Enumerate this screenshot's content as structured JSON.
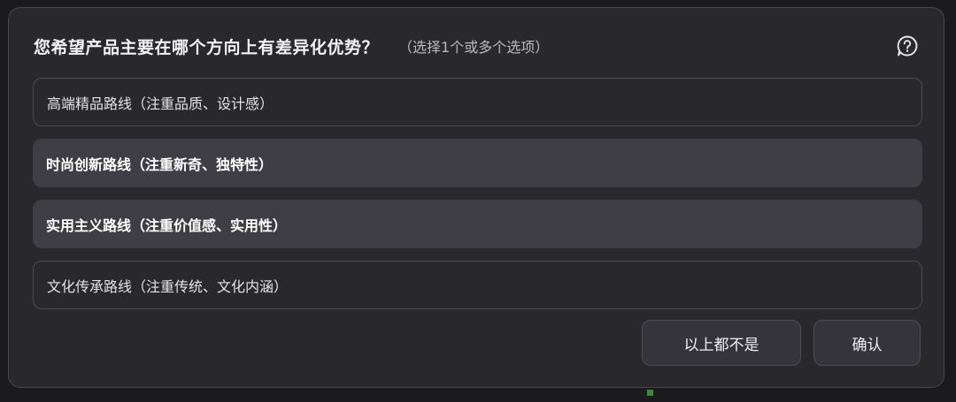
{
  "question": {
    "title": "您希望产品主要在哪个方向上有差异化优势？",
    "hint": "（选择1个或多个选项）",
    "help_icon": "help-question-icon"
  },
  "options": [
    {
      "label": "高端精品路线（注重品质、设计感）",
      "selected": false
    },
    {
      "label": "时尚创新路线（注重新奇、独特性）",
      "selected": true
    },
    {
      "label": "实用主义路线（注重价值感、实用性）",
      "selected": true
    },
    {
      "label": "文化传承路线（注重传统、文化内涵）",
      "selected": false
    }
  ],
  "actions": {
    "none_label": "以上都不是",
    "confirm_label": "确认"
  },
  "colors": {
    "panel_bg": "#29292c",
    "selected_bg": "#3e3e44",
    "border": "#4a4a50",
    "status_green": "#3a8a3c"
  }
}
